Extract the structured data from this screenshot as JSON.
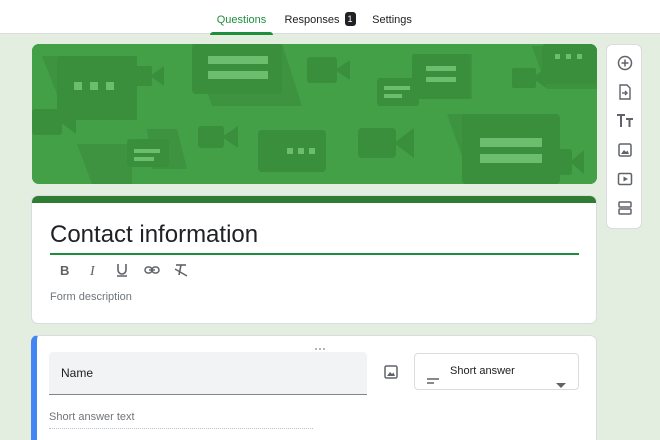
{
  "tabs": [
    {
      "label": "Questions",
      "active": true
    },
    {
      "label": "Responses",
      "badge": "1",
      "active": false
    },
    {
      "label": "Settings",
      "active": false
    }
  ],
  "form": {
    "title": "Contact information",
    "description_placeholder": "Form description"
  },
  "question": {
    "title": "Name",
    "type": "Short answer",
    "answer_placeholder": "Short answer text"
  },
  "colors": {
    "accent": "#1e8e3e",
    "header_strip": "#2e7d32",
    "banner": "#43a047",
    "selected_question": "#4285f4",
    "page_background": "#e3eee0"
  },
  "toolbar_icons": [
    "add-question-icon",
    "import-questions-icon",
    "add-title-icon",
    "add-image-icon",
    "add-video-icon",
    "add-section-icon"
  ],
  "format_icons": [
    "bold-icon",
    "italic-icon",
    "underline-icon",
    "link-icon",
    "clear-format-icon"
  ]
}
